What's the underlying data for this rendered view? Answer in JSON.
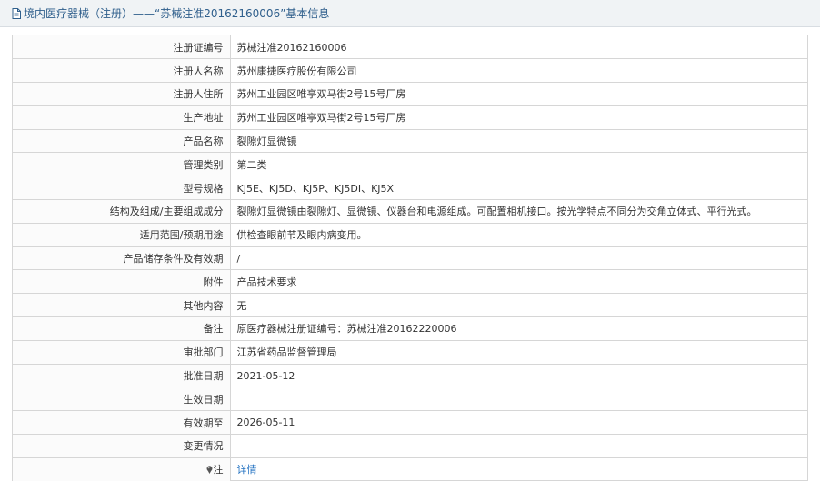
{
  "header": {
    "title": "境内医疗器械（注册）——“苏械注准20162160006”基本信息",
    "icon": "document-icon"
  },
  "rows": [
    {
      "label": "注册证编号",
      "value": "苏械注准20162160006"
    },
    {
      "label": "注册人名称",
      "value": "苏州康捷医疗股份有限公司"
    },
    {
      "label": "注册人住所",
      "value": "苏州工业园区唯亭双马街2号15号厂房"
    },
    {
      "label": "生产地址",
      "value": "苏州工业园区唯亭双马街2号15号厂房"
    },
    {
      "label": "产品名称",
      "value": "裂隙灯显微镜"
    },
    {
      "label": "管理类别",
      "value": "第二类"
    },
    {
      "label": "型号规格",
      "value": "KJ5E、KJ5D、KJ5P、KJ5DI、KJ5X"
    },
    {
      "label": "结构及组成/主要组成成分",
      "value": "裂隙灯显微镜由裂隙灯、显微镜、仪器台和电源组成。可配置相机接口。按光学特点不同分为交角立体式、平行光式。"
    },
    {
      "label": "适用范围/预期用途",
      "value": "供检查眼前节及眼内病变用。"
    },
    {
      "label": "产品储存条件及有效期",
      "value": "/"
    },
    {
      "label": "附件",
      "value": "产品技术要求"
    },
    {
      "label": "其他内容",
      "value": "无"
    },
    {
      "label": "备注",
      "value": "原医疗器械注册证编号：苏械注准20162220006"
    },
    {
      "label": "审批部门",
      "value": "江苏省药品监督管理局"
    },
    {
      "label": "批准日期",
      "value": "2021-05-12"
    },
    {
      "label": "生效日期",
      "value": ""
    },
    {
      "label": "有效期至",
      "value": "2026-05-11"
    },
    {
      "label": "变更情况",
      "value": ""
    }
  ],
  "note": {
    "label": "注",
    "link_text": "详情",
    "icon": "pin-icon"
  },
  "colors": {
    "header_text": "#2f5f8c",
    "link": "#1e6fc0",
    "border": "#d6d6d6"
  }
}
